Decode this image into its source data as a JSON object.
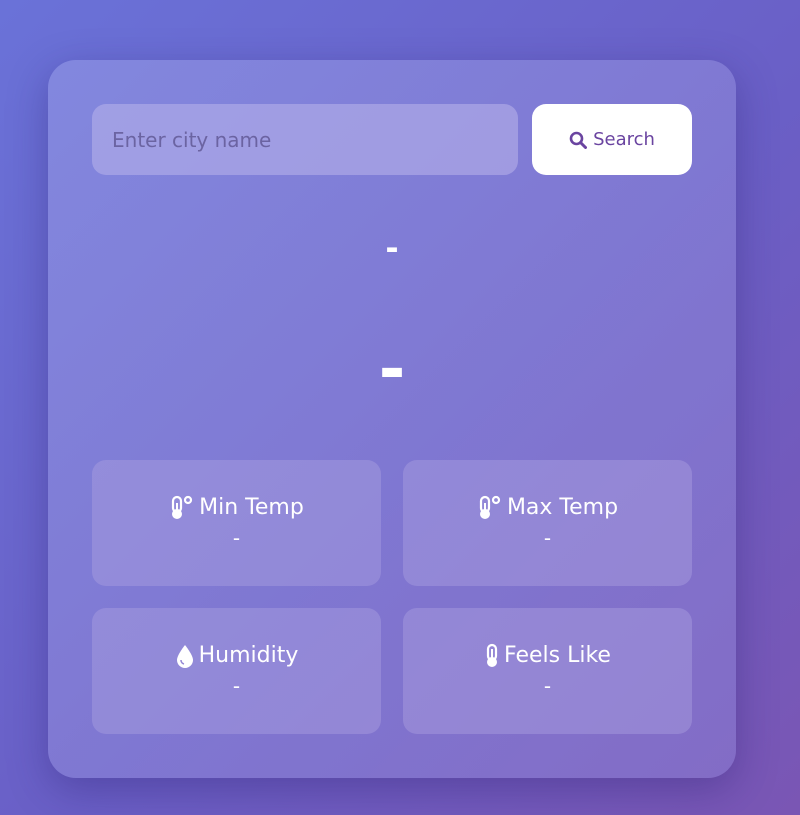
{
  "search": {
    "placeholder": "Enter city name",
    "value": "",
    "button_label": "Search",
    "button_icon": "magnifier-icon"
  },
  "weather": {
    "city": "-",
    "temperature": "-"
  },
  "details": [
    {
      "label": "Min Temp",
      "value": "-",
      "icon": "thermometer-degree-icon"
    },
    {
      "label": "Max Temp",
      "value": "-",
      "icon": "thermometer-degree-icon"
    },
    {
      "label": "Humidity",
      "value": "-",
      "icon": "droplet-icon"
    },
    {
      "label": "Feels Like",
      "value": "-",
      "icon": "thermometer-icon"
    }
  ],
  "colors": {
    "accent": "#6a44a0",
    "background_start": "#6a72d8",
    "background_end": "#7a56b4"
  }
}
